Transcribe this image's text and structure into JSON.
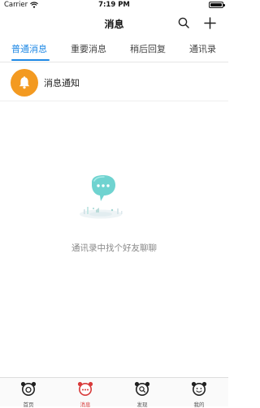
{
  "status_bar": {
    "carrier": "Carrier",
    "time": "7:19 PM"
  },
  "nav": {
    "title": "消息",
    "search_icon": "search-icon",
    "add_icon": "plus-icon"
  },
  "tabs": [
    {
      "label": "普通消息",
      "active": true
    },
    {
      "label": "重要消息",
      "active": false
    },
    {
      "label": "稍后回复",
      "active": false
    },
    {
      "label": "通讯录",
      "active": false
    }
  ],
  "notification": {
    "label": "消息通知",
    "icon": "bell-icon",
    "color": "#f39a21"
  },
  "empty_state": {
    "text": "通讯录中找个好友聊聊"
  },
  "tabbar": [
    {
      "label": "首页",
      "icon": "home-icon",
      "active": false
    },
    {
      "label": "消息",
      "icon": "chat-icon",
      "active": true
    },
    {
      "label": "发现",
      "icon": "discover-icon",
      "active": false
    },
    {
      "label": "我的",
      "icon": "profile-icon",
      "active": false
    }
  ],
  "colors": {
    "accent": "#1e88e5",
    "tabbar_active": "#d83a3a"
  }
}
